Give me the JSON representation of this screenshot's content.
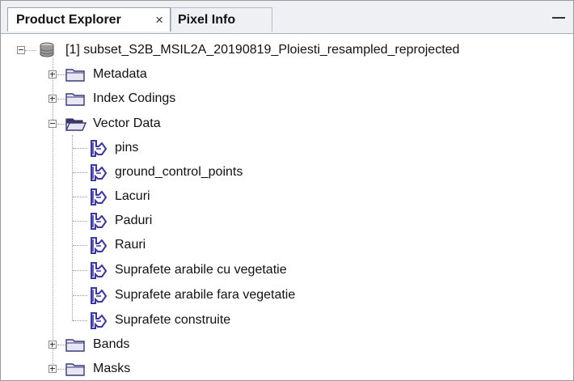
{
  "tabs": {
    "product_explorer": "Product Explorer",
    "close_glyph": "×",
    "pixel_info": "Pixel Info"
  },
  "tree": {
    "root_label": "[1] subset_S2B_MSIL2A_20190819_Ploiesti_resampled_reprojected",
    "metadata": "Metadata",
    "index_codings": "Index Codings",
    "vector_data": "Vector Data",
    "vector_items": [
      "pins",
      "ground_control_points",
      "Lacuri",
      "Paduri",
      "Rauri",
      "Suprafete arabile cu vegetatie",
      "Suprafete arabile fara vegetatie",
      "Suprafete construite"
    ],
    "bands": "Bands",
    "masks": "Masks"
  },
  "colors": {
    "folder_fill": "#e6e6f4",
    "folder_stroke": "#3a3a7a",
    "vector_icon": "#3a36a8"
  }
}
